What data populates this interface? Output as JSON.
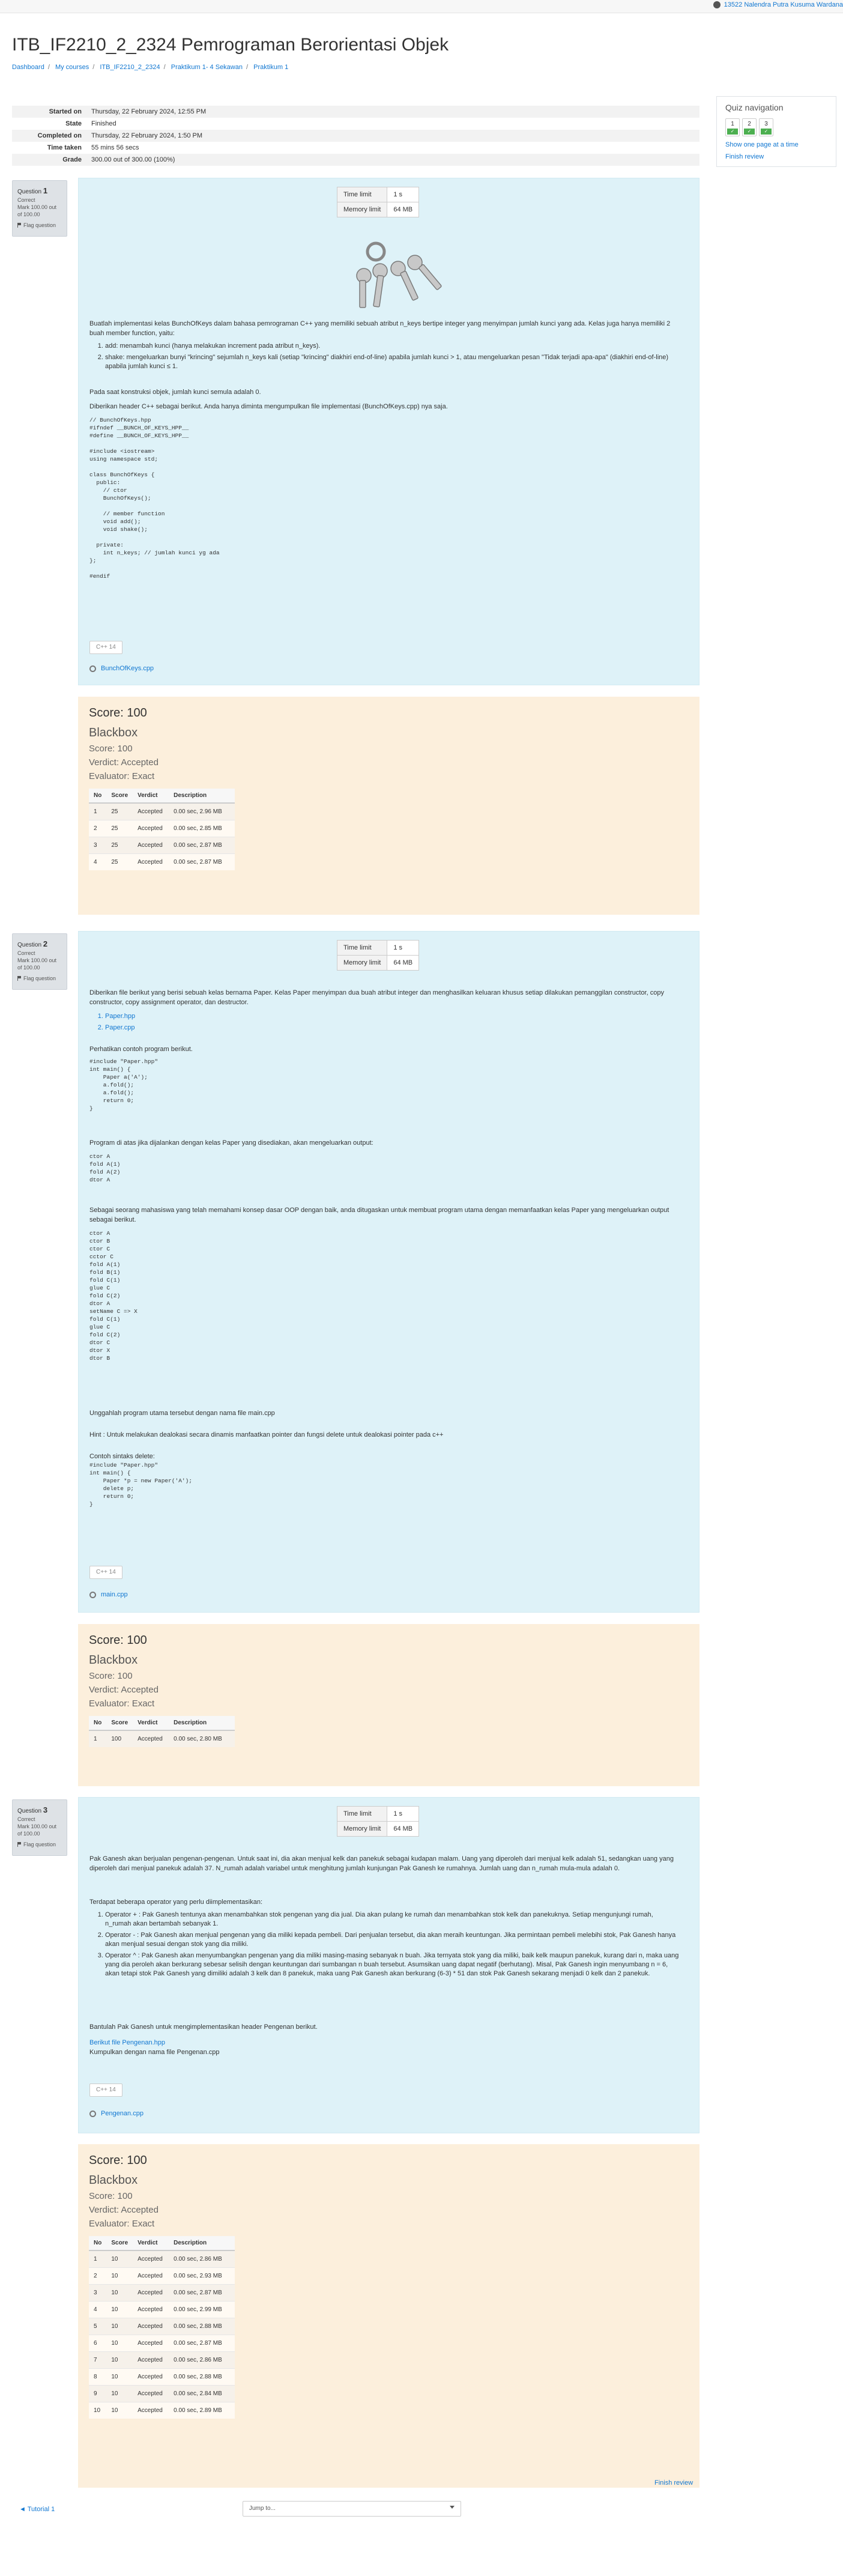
{
  "user": {
    "name": "13522 Nalendra Putra Kusuma Wardana"
  },
  "course_title": "ITB_IF2210_2_2324 Pemrograman Berorientasi Objek",
  "breadcrumbs": [
    "Dashboard",
    "My courses",
    "ITB_IF2210_2_2324",
    "Praktikum 1- 4 Sekawan",
    "Praktikum 1"
  ],
  "summary": [
    {
      "label": "Started on",
      "value": "Thursday, 22 February 2024, 12:55 PM"
    },
    {
      "label": "State",
      "value": "Finished"
    },
    {
      "label": "Completed on",
      "value": "Thursday, 22 February 2024, 1:50 PM"
    },
    {
      "label": "Time taken",
      "value": "55 mins 56 secs"
    },
    {
      "label": "Grade",
      "value": "300.00 out of 300.00 (100%)"
    }
  ],
  "quiz_nav": {
    "title": "Quiz navigation",
    "buttons": [
      "1",
      "2",
      "3"
    ],
    "show_one_page": "Show one page at a time",
    "finish_review": "Finish review"
  },
  "qinfo_common": {
    "status": "Correct",
    "mark": "Mark 100.00 out of 100.00",
    "flag": "Flag question"
  },
  "q1": {
    "label": "Question",
    "number": "1",
    "limits": {
      "time_label": "Time limit",
      "time": "1 s",
      "mem_label": "Memory limit",
      "mem": "64 MB"
    },
    "intro": "Buatlah implementasi kelas BunchOfKeys dalam bahasa pemrograman C++ yang memiliki sebuah atribut n_keys bertipe integer yang menyimpan jumlah kunci yang ada. Kelas juga hanya memiliki 2 buah member function, yaitu:",
    "items": [
      "add: menambah kunci (hanya melakukan increment pada atribut n_keys).",
      "shake: mengeluarkan bunyi \"krincing\" sejumlah n_keys kali (setiap \"krincing\" diakhiri end-of-line) apabila jumlah kunci > 1, atau mengeluarkan pesan \"Tidak terjadi apa-apa\" (diakhiri end-of-line) apabila jumlah kunci ≤ 1."
    ],
    "p2": "Pada saat konstruksi objek, jumlah kunci semula adalah 0.",
    "p3": "Diberikan header C++ sebagai berikut. Anda hanya diminta mengumpulkan file implementasi (BunchOfKeys.cpp) nya saja.",
    "code": "// BunchOfKeys.hpp\n#ifndef __BUNCH_OF_KEYS_HPP__\n#define __BUNCH_OF_KEYS_HPP__\n\n#include <iostream>\nusing namespace std;\n\nclass BunchOfKeys {\n  public:\n    // ctor\n    BunchOfKeys();\n\n    // member function\n    void add();\n    void shake();\n\n  private:\n    int n_keys; // jumlah kunci yg ada\n};\n\n#endif",
    "lang": "C++ 14",
    "file": "BunchOfKeys.cpp"
  },
  "fb1": {
    "score": "Score: 100",
    "blackbox": "Blackbox",
    "score2": "Score: 100",
    "verdict": "Verdict: Accepted",
    "evaluator": "Evaluator: Exact",
    "headers": [
      "No",
      "Score",
      "Verdict",
      "Description"
    ],
    "rows": [
      [
        "1",
        "25",
        "Accepted",
        "0.00 sec, 2.96 MB"
      ],
      [
        "2",
        "25",
        "Accepted",
        "0.00 sec, 2.85 MB"
      ],
      [
        "3",
        "25",
        "Accepted",
        "0.00 sec, 2.87 MB"
      ],
      [
        "4",
        "25",
        "Accepted",
        "0.00 sec, 2.87 MB"
      ]
    ]
  },
  "q2": {
    "label": "Question",
    "number": "2",
    "limits": {
      "time_label": "Time limit",
      "time": "1 s",
      "mem_label": "Memory limit",
      "mem": "64 MB"
    },
    "intro": "Diberikan file berikut yang berisi sebuah kelas bernama Paper. Kelas Paper menyimpan dua buah atribut integer dan menghasilkan keluaran khusus setiap dilakukan pemanggilan constructor, copy constructor, copy assignment operator, dan destructor.",
    "files": [
      "Paper.hpp",
      "Paper.cpp"
    ],
    "p_example": "Perhatikan contoh program berikut.",
    "code1": "#include \"Paper.hpp\"\nint main() {\n    Paper a('A');\n    a.fold();\n    a.fold();\n    return 0;\n}",
    "p_output": "Program di atas jika dijalankan dengan kelas Paper yang disediakan, akan mengeluarkan output:",
    "out1": "ctor A\nfold A(1)\nfold A(2)\ndtor A",
    "p_task": "Sebagai seorang mahasiswa yang telah memahami konsep dasar OOP dengan baik, anda ditugaskan untuk membuat program utama dengan memanfaatkan kelas Paper yang mengeluarkan output sebagai berikut.",
    "out2": "ctor A\nctor B\nctor C\ncctor C\nfold A(1)\nfold B(1)\nfold C(1)\nglue C\nfold C(2)\ndtor A\nsetName C => X\nfold C(1)\nglue C\nfold C(2)\ndtor C\ndtor X\ndtor B",
    "p_submit": "Unggahlah program utama tersebut dengan nama file main.cpp",
    "p_hint": "Hint : Untuk melakukan dealokasi secara dinamis manfaatkan pointer dan fungsi delete untuk dealokasi pointer pada c++",
    "p_delete": "Contoh sintaks delete:",
    "code2": "#include \"Paper.hpp\"\nint main() {\n    Paper *p = new Paper('A');\n    delete p;\n    return 0;\n}",
    "lang": "C++ 14",
    "file": "main.cpp"
  },
  "fb2": {
    "score": "Score: 100",
    "blackbox": "Blackbox",
    "score2": "Score: 100",
    "verdict": "Verdict: Accepted",
    "evaluator": "Evaluator: Exact",
    "headers": [
      "No",
      "Score",
      "Verdict",
      "Description"
    ],
    "rows": [
      [
        "1",
        "100",
        "Accepted",
        "0.00 sec, 2.80 MB"
      ]
    ]
  },
  "q3": {
    "label": "Question",
    "number": "3",
    "limits": {
      "time_label": "Time limit",
      "time": "1 s",
      "mem_label": "Memory limit",
      "mem": "64 MB"
    },
    "intro": "Pak Ganesh akan berjualan pengenan-pengenan. Untuk saat ini, dia akan menjual kelk dan panekuk sebagai kudapan malam. Uang yang diperoleh dari menjual kelk adalah 51, sedangkan uang yang diperoleh dari menjual panekuk adalah 37. N_rumah adalah variabel untuk menghitung jumlah kunjungan Pak Ganesh ke rumahnya. Jumlah uang dan n_rumah mula-mula adalah 0.",
    "p_ops": "Terdapat beberapa operator yang perlu diimplementasikan:",
    "ops": [
      "Operator + : Pak Ganesh tentunya akan menambahkan stok pengenan yang dia jual. Dia akan pulang ke rumah dan menambahkan stok kelk dan panekuknya. Setiap mengunjungi rumah, n_rumah akan bertambah sebanyak 1.",
      "Operator - : Pak Ganesh akan menjual pengenan yang dia miliki kepada pembeli. Dari penjualan tersebut, dia akan meraih keuntungan. Jika permintaan pembeli melebihi stok, Pak Ganesh hanya akan menjual sesuai dengan stok yang dia miliki.",
      "Operator ^ : Pak Ganesh akan menyumbangkan pengenan yang dia miliki masing-masing sebanyak n buah. Jika ternyata stok yang dia miliki, baik kelk maupun panekuk, kurang dari n, maka uang yang dia peroleh akan berkurang sebesar selisih dengan keuntungan dari sumbangan n buah tersebut. Asumsikan uang dapat negatif (berhutang). Misal, Pak Ganesh ingin menyumbang n = 6, akan tetapi stok Pak Ganesh yang dimiliki adalah 3 kelk dan 8 panekuk, maka uang Pak Ganesh akan berkurang (6-3) * 51 dan stok Pak Ganesh sekarang menjadi 0 kelk dan 2 panekuk."
    ],
    "p_help": "Bantulah Pak Ganesh untuk mengimplementasikan header Pengenan berikut.",
    "p_file": "Berikut file Pengenan.hpp",
    "p_collect": "Kumpulkan dengan nama file Pengenan.cpp",
    "lang": "C++ 14",
    "file": "Pengenan.cpp"
  },
  "fb3": {
    "score": "Score: 100",
    "blackbox": "Blackbox",
    "score2": "Score: 100",
    "verdict": "Verdict: Accepted",
    "evaluator": "Evaluator: Exact",
    "headers": [
      "No",
      "Score",
      "Verdict",
      "Description"
    ],
    "rows": [
      [
        "1",
        "10",
        "Accepted",
        "0.00 sec, 2.86 MB"
      ],
      [
        "2",
        "10",
        "Accepted",
        "0.00 sec, 2.93 MB"
      ],
      [
        "3",
        "10",
        "Accepted",
        "0.00 sec, 2.87 MB"
      ],
      [
        "4",
        "10",
        "Accepted",
        "0.00 sec, 2.99 MB"
      ],
      [
        "5",
        "10",
        "Accepted",
        "0.00 sec, 2.88 MB"
      ],
      [
        "6",
        "10",
        "Accepted",
        "0.00 sec, 2.87 MB"
      ],
      [
        "7",
        "10",
        "Accepted",
        "0.00 sec, 2.86 MB"
      ],
      [
        "8",
        "10",
        "Accepted",
        "0.00 sec, 2.88 MB"
      ],
      [
        "9",
        "10",
        "Accepted",
        "0.00 sec, 2.84 MB"
      ],
      [
        "10",
        "10",
        "Accepted",
        "0.00 sec, 2.89 MB"
      ]
    ]
  },
  "footer": {
    "finish_review": "Finish review",
    "prev_link": "◄ Tutorial 1",
    "jump_to": "Jump to..."
  }
}
